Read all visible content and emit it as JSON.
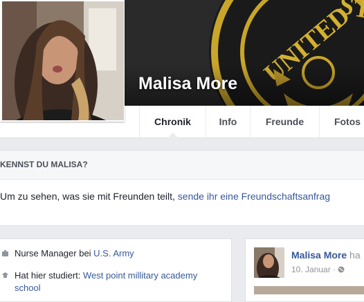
{
  "profile": {
    "name": "Malisa More"
  },
  "nav": {
    "tabs": [
      {
        "label": "Chronik"
      },
      {
        "label": "Info"
      },
      {
        "label": "Freunde"
      },
      {
        "label": "Fotos"
      }
    ]
  },
  "know": {
    "heading": "KENNST DU MALISA?",
    "text_prefix": "Um zu sehen, was sie mit Freunden teilt, ",
    "link": "sende ihr eine Freundschaftsanfrag"
  },
  "about": {
    "work_prefix": "Nurse Manager bei ",
    "work_link": "U.S. Army",
    "study_prefix": "Hat hier studiert: ",
    "study_link": "West point millitary academy school"
  },
  "post": {
    "author": "Malisa More",
    "author_suffix": " ha",
    "date": "10. Januar",
    "separator": " · "
  },
  "colors": {
    "link": "#365899",
    "background": "#e9ebee"
  }
}
